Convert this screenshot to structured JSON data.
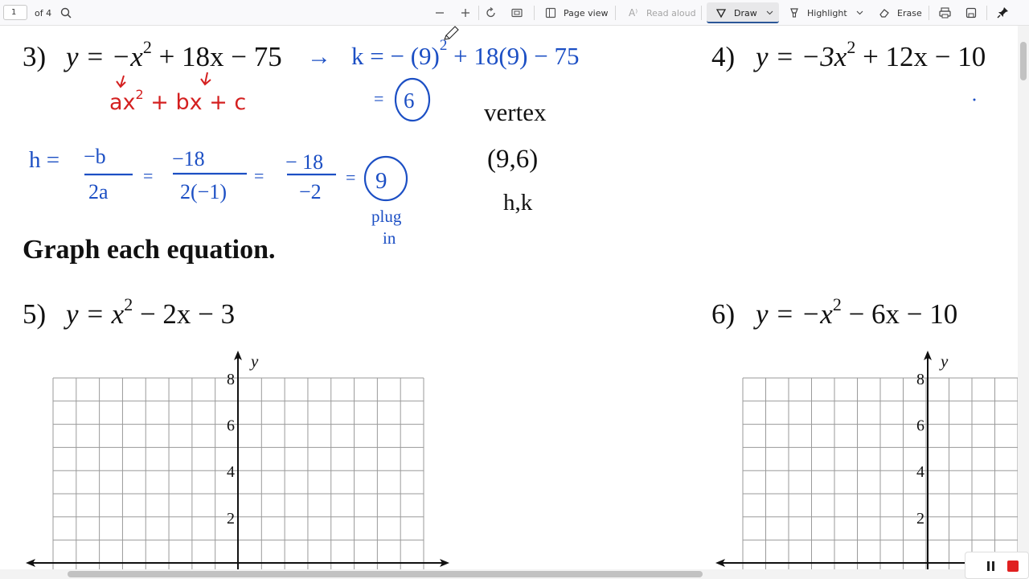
{
  "toolbar": {
    "page_number": "1",
    "page_count": "of 4",
    "page_view": "Page view",
    "read_aloud": "Read aloud",
    "draw": "Draw",
    "highlight": "Highlight",
    "erase": "Erase"
  },
  "problems": {
    "p3": {
      "num": "3)",
      "eq": [
        "y = −x",
        "2",
        " + 18x − 75"
      ]
    },
    "p4": {
      "num": "4)",
      "eq": [
        "y = −3x",
        "2",
        " + 12x − 10"
      ]
    },
    "p5": {
      "num": "5)",
      "eq": [
        "y = x",
        "2",
        " − 2x − 3"
      ]
    },
    "p6": {
      "num": "6)",
      "eq": [
        "y = −x",
        "2",
        " − 6x − 10"
      ]
    }
  },
  "section_title": "Graph each equation.",
  "handwriting": {
    "arrow": "→",
    "k_expr": [
      "k = − (9)",
      "2",
      " + 18(9) − 75"
    ],
    "k_eq": "=",
    "k_val": "6",
    "form": [
      "ax",
      "2",
      " + bx + c"
    ],
    "h_lhs": "h =",
    "h_num1": "−b",
    "h_den1": "2a",
    "h_num2": "−18",
    "h_den2": "2(−1)",
    "h_num3": "− 18",
    "h_den3": "−2",
    "eq": "=",
    "h_val": "9",
    "plug": "plug",
    "in": "in",
    "vertex_label": "vertex",
    "vertex_point": "(9,6)",
    "vertex_hk": "h,k"
  },
  "graph": {
    "axis_label": "y",
    "y_ticks": [
      "8",
      "6",
      "4",
      "2"
    ]
  },
  "colors": {
    "blue_ink": "#1c4fc4",
    "red_ink": "#d42020"
  }
}
